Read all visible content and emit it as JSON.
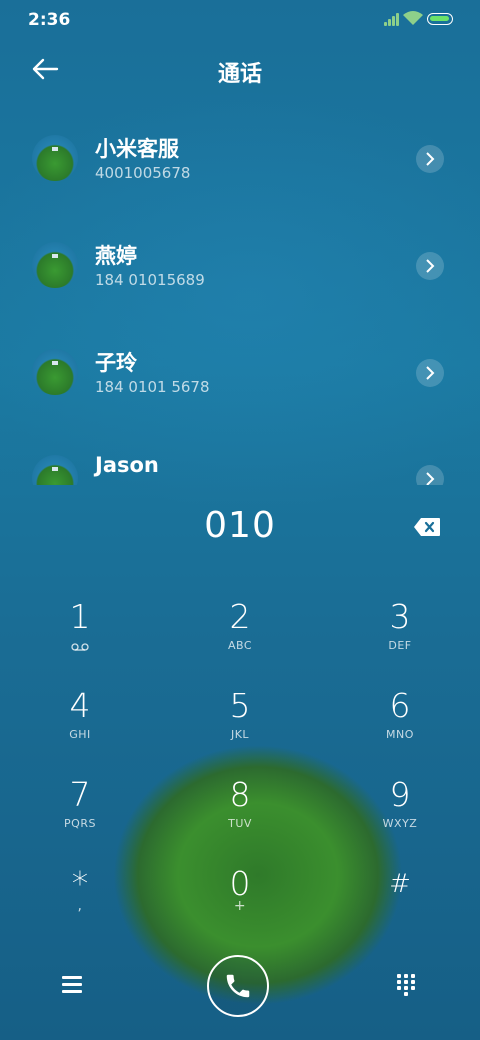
{
  "status_bar": {
    "time": "2:36"
  },
  "header": {
    "title": "通话"
  },
  "contacts": [
    {
      "name": "小米客服",
      "number": "4001005678"
    },
    {
      "name": "燕婷",
      "number": "184 01015689"
    },
    {
      "name": "子玲",
      "number": "184 0101 5678"
    },
    {
      "name": "Jason",
      "number": ""
    }
  ],
  "dialer": {
    "number": "010",
    "keys": [
      {
        "digit": "1",
        "letters": ""
      },
      {
        "digit": "2",
        "letters": "ABC"
      },
      {
        "digit": "3",
        "letters": "DEF"
      },
      {
        "digit": "4",
        "letters": "GHI"
      },
      {
        "digit": "5",
        "letters": "JKL"
      },
      {
        "digit": "6",
        "letters": "MNO"
      },
      {
        "digit": "7",
        "letters": "PQRS"
      },
      {
        "digit": "8",
        "letters": "TUV"
      },
      {
        "digit": "9",
        "letters": "WXYZ"
      },
      {
        "digit": "*",
        "letters": ","
      },
      {
        "digit": "0",
        "letters": "+"
      },
      {
        "digit": "#",
        "letters": ""
      }
    ]
  },
  "icons": {
    "back": "back-arrow-icon",
    "contact_info": "chevron-right-icon",
    "backspace": "backspace-icon",
    "voicemail": "voicemail-icon",
    "menu": "menu-icon",
    "call": "phone-icon",
    "dialpad": "dialpad-icon"
  },
  "colors": {
    "background": "#1a6f99",
    "battery": "#6ce36a",
    "signal": "#8ed08a"
  }
}
